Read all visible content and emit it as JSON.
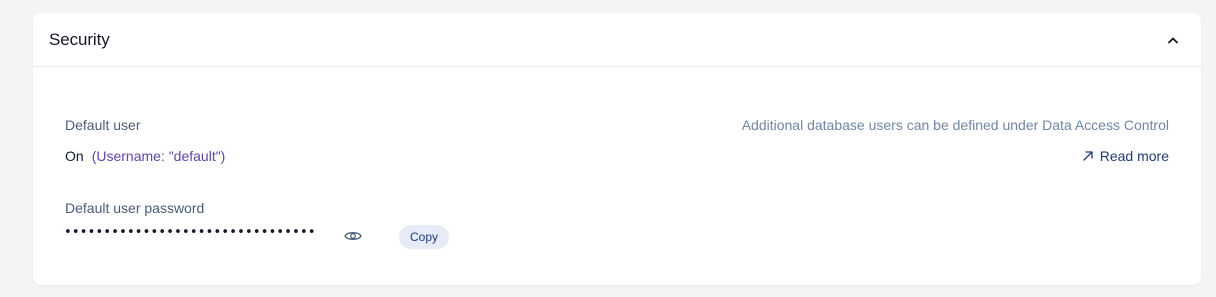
{
  "section": {
    "title": "Security"
  },
  "default_user": {
    "label": "Default user",
    "status": "On",
    "username_note": "(Username: \"default\")"
  },
  "info": {
    "text": "Additional database users can be defined under Data Access Control",
    "read_more_label": "Read more"
  },
  "password": {
    "label": "Default user password",
    "masked_value": "••••••••••••••••••••••••••••••••",
    "copy_label": "Copy"
  },
  "icons": {
    "collapse": "chevron-up-icon",
    "external_link": "arrow-up-right-icon",
    "reveal": "eye-icon"
  },
  "colors": {
    "accent": "#1d3a7a",
    "username": "#5b46b2",
    "muted_text": "#4a5d7a",
    "copy_button_bg": "#e5ebf7"
  }
}
